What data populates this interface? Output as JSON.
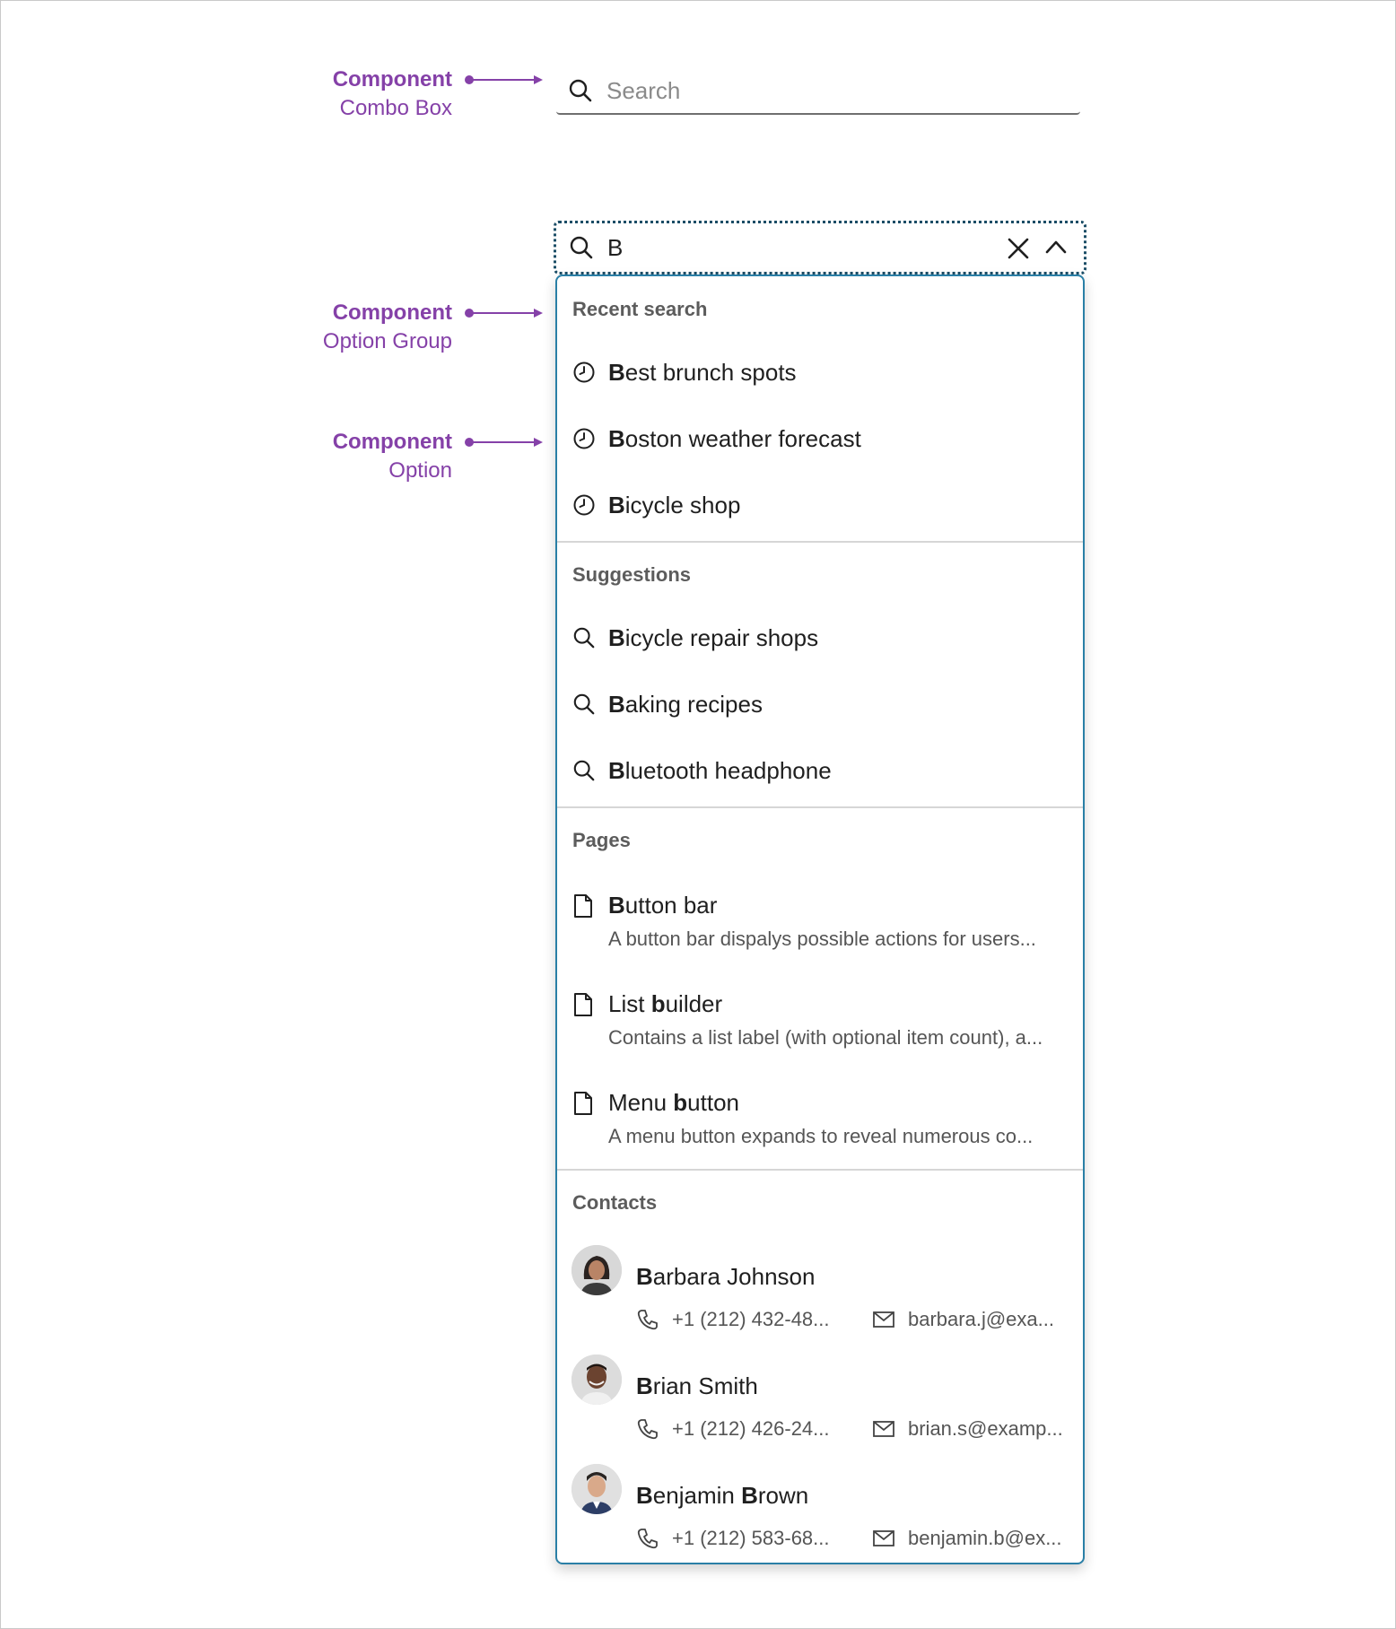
{
  "annotations": [
    {
      "title": "Component",
      "subtitle": "Combo Box"
    },
    {
      "title": "Component",
      "subtitle": "Option Group"
    },
    {
      "title": "Component",
      "subtitle": "Option"
    }
  ],
  "combo_default": {
    "placeholder": "Search",
    "icon": "search-icon"
  },
  "combo_open": {
    "value": "B",
    "icons": [
      "search-icon",
      "close-icon",
      "chevron-up-icon"
    ]
  },
  "groups": {
    "recent": {
      "label": "Recent search",
      "options": [
        {
          "match": "B",
          "rest": "est brunch spots",
          "icon": "clock-icon"
        },
        {
          "match": "B",
          "rest": "oston weather forecast",
          "icon": "clock-icon"
        },
        {
          "match": "B",
          "rest": "icycle shop",
          "icon": "clock-icon"
        }
      ]
    },
    "suggestions": {
      "label": "Suggestions",
      "options": [
        {
          "match": "B",
          "rest": "icycle repair shops",
          "icon": "search-icon"
        },
        {
          "match": "B",
          "rest": "aking recipes",
          "icon": "search-icon"
        },
        {
          "match": "B",
          "rest": "luetooth headphone",
          "icon": "search-icon"
        }
      ]
    },
    "pages": {
      "label": "Pages",
      "options": [
        {
          "pre": "",
          "match": "B",
          "rest": "utton bar",
          "desc": "A button bar dispalys possible actions for users...",
          "icon": "document-icon"
        },
        {
          "pre": "List ",
          "match": "b",
          "rest": "uilder",
          "desc": "Contains a list label (with optional item count), a...",
          "icon": "document-icon"
        },
        {
          "pre": "Menu ",
          "match": "b",
          "rest": "utton",
          "desc": "A menu button expands to reveal numerous co...",
          "icon": "document-icon"
        }
      ]
    },
    "contacts": {
      "label": "Contacts",
      "options": [
        {
          "first_match": "B",
          "first_rest": "arbara ",
          "last_match": "",
          "last_rest": "Johnson",
          "phone": "+1 (212) 432-48...",
          "email": "barbara.j@exa..."
        },
        {
          "first_match": "B",
          "first_rest": "rian ",
          "last_match": "",
          "last_rest": "Smith",
          "phone": "+1 (212) 426-24...",
          "email": "brian.s@examp..."
        },
        {
          "first_match": "B",
          "first_rest": "enjamin ",
          "last_match": "B",
          "last_rest": "rown",
          "phone": "+1 (212) 583-68...",
          "email": "benjamin.b@ex..."
        }
      ]
    }
  },
  "colors": {
    "annotation": "#8541a8",
    "focus_ring": "#1b4d66",
    "listbox_border": "#2a7fa6"
  }
}
